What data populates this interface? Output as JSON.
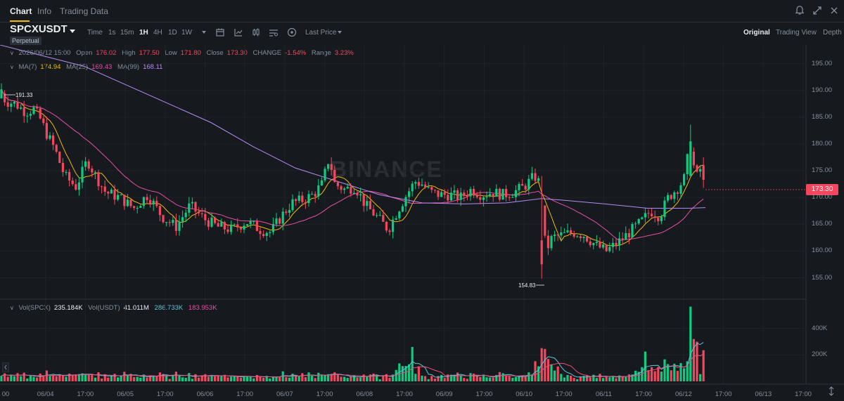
{
  "tabs": [
    {
      "label": "Chart",
      "active": true
    },
    {
      "label": "Info",
      "active": false
    },
    {
      "label": "Trading Data",
      "active": false
    }
  ],
  "top_icons": [
    "bell-icon",
    "expand-icon",
    "close-icon"
  ],
  "symbol": "SPCXUSDT",
  "contract_type": "Perpetual",
  "timeframes": [
    {
      "label": "Time",
      "active": false
    },
    {
      "label": "1s",
      "active": false
    },
    {
      "label": "15m",
      "active": false
    },
    {
      "label": "1H",
      "active": true
    },
    {
      "label": "4H",
      "active": false
    },
    {
      "label": "1D",
      "active": false
    },
    {
      "label": "1W",
      "active": false
    }
  ],
  "tool_icons": [
    "more-timeframes-icon",
    "calendar-icon",
    "indicator-icon",
    "candle-type-icon",
    "settings-icon",
    "add-indicator-icon"
  ],
  "price_type": "Last Price",
  "views": [
    {
      "label": "Original",
      "active": true
    },
    {
      "label": "Trading View",
      "active": false
    },
    {
      "label": "Depth",
      "active": false
    }
  ],
  "ohlc": {
    "date": "2026/06/12 15:00",
    "open_label": "Open",
    "open": "176.02",
    "high_label": "High",
    "high": "177.50",
    "low_label": "Low",
    "low": "171.80",
    "close_label": "Close",
    "close": "173.30",
    "change_label": "CHANGE",
    "change": "-1.54%",
    "range_label": "Range",
    "range": "3.23%"
  },
  "ma": {
    "ma7_label": "MA(7)",
    "ma7": "174.94",
    "ma25_label": "MA(25)",
    "ma25": "169.43",
    "ma99_label": "MA(99)",
    "ma99": "168.11"
  },
  "volume": {
    "vol_label": "Vol(SPCX)",
    "vol": "235.184K",
    "vol_usdt_label": "Vol(USDT)",
    "vol_usdt": "41.011M",
    "ma5": "286.733K",
    "ma10": "183.953K"
  },
  "watermark": "BINANCE",
  "current_price": "173.30",
  "annotations": {
    "high": "191.33",
    "low": "154.83"
  },
  "colors": {
    "up": "#0ecb81",
    "down": "#f6465d",
    "ma7": "#f0b90b",
    "ma25": "#e84fa5",
    "ma99": "#b48cf2",
    "vol_ma5": "#5fc5d8",
    "vol_ma10": "#e84f7d"
  },
  "chart_data": {
    "type": "candlestick",
    "interval": "1H",
    "price_axis": {
      "ticks": [
        "195.00",
        "190.00",
        "185.00",
        "180.00",
        "175.00",
        "170.00",
        "165.00",
        "160.00",
        "155.00"
      ],
      "ylim": [
        151,
        198.5
      ]
    },
    "volume_axis": {
      "ticks": [
        "400K",
        "200K"
      ],
      "ylim": [
        0,
        600000
      ]
    },
    "x_ticks": [
      "00",
      "06/04",
      "17:00",
      "06/05",
      "17:00",
      "06/06",
      "17:00",
      "06/07",
      "17:00",
      "06/08",
      "17:00",
      "06/09",
      "17:00",
      "06/10",
      "17:00",
      "06/11",
      "17:00",
      "06/12",
      "17:00",
      "06/13",
      "17:00"
    ],
    "anchors": [
      {
        "x": 0,
        "c": 190.0
      },
      {
        "x": 8,
        "c": 188.0
      },
      {
        "x": 22,
        "c": 187.5
      },
      {
        "x": 36,
        "c": 186.0
      },
      {
        "x": 48,
        "c": 186.5
      },
      {
        "x": 58,
        "c": 184.5
      },
      {
        "x": 66,
        "c": 182.0
      },
      {
        "x": 78,
        "c": 179.0
      },
      {
        "x": 92,
        "c": 174.0
      },
      {
        "x": 108,
        "c": 172.0
      },
      {
        "x": 118,
        "c": 175.0
      },
      {
        "x": 124,
        "c": 177.0
      },
      {
        "x": 134,
        "c": 174.5
      },
      {
        "x": 150,
        "c": 171.0
      },
      {
        "x": 170,
        "c": 170.0
      },
      {
        "x": 190,
        "c": 168.0
      },
      {
        "x": 210,
        "c": 170.5
      },
      {
        "x": 230,
        "c": 166.5
      },
      {
        "x": 250,
        "c": 164.5
      },
      {
        "x": 270,
        "c": 168.5
      },
      {
        "x": 290,
        "c": 166.0
      },
      {
        "x": 310,
        "c": 164.5
      },
      {
        "x": 330,
        "c": 164.0
      },
      {
        "x": 350,
        "c": 165.5
      },
      {
        "x": 370,
        "c": 164.0
      },
      {
        "x": 385,
        "c": 163.5
      },
      {
        "x": 400,
        "c": 166.5
      },
      {
        "x": 415,
        "c": 169.0
      },
      {
        "x": 430,
        "c": 169.5
      },
      {
        "x": 445,
        "c": 170.5
      },
      {
        "x": 458,
        "c": 172.5
      },
      {
        "x": 468,
        "c": 177.5
      },
      {
        "x": 476,
        "c": 172.5
      },
      {
        "x": 490,
        "c": 171.5
      },
      {
        "x": 505,
        "c": 172.0
      },
      {
        "x": 520,
        "c": 168.5
      },
      {
        "x": 535,
        "c": 166.5
      },
      {
        "x": 552,
        "c": 164.0
      },
      {
        "x": 565,
        "c": 167.5
      },
      {
        "x": 578,
        "c": 170.5
      },
      {
        "x": 590,
        "c": 173.0
      },
      {
        "x": 600,
        "c": 172.5
      },
      {
        "x": 612,
        "c": 171.0
      },
      {
        "x": 625,
        "c": 170.5
      },
      {
        "x": 640,
        "c": 170.5
      },
      {
        "x": 655,
        "c": 170.0
      },
      {
        "x": 670,
        "c": 171.5
      },
      {
        "x": 685,
        "c": 170.5
      },
      {
        "x": 700,
        "c": 171.0
      },
      {
        "x": 715,
        "c": 170.5
      },
      {
        "x": 730,
        "c": 171.0
      },
      {
        "x": 745,
        "c": 172.0
      },
      {
        "x": 760,
        "c": 174.0
      },
      {
        "x": 768,
        "c": 172.5
      },
      {
        "x": 776,
        "c": 160.0
      },
      {
        "x": 785,
        "c": 162.5
      },
      {
        "x": 800,
        "c": 163.0
      },
      {
        "x": 815,
        "c": 163.5
      },
      {
        "x": 830,
        "c": 163.0
      },
      {
        "x": 848,
        "c": 161.0
      },
      {
        "x": 862,
        "c": 160.0
      },
      {
        "x": 878,
        "c": 161.5
      },
      {
        "x": 895,
        "c": 163.5
      },
      {
        "x": 912,
        "c": 165.5
      },
      {
        "x": 925,
        "c": 167.5
      },
      {
        "x": 938,
        "c": 166.5
      },
      {
        "x": 950,
        "c": 170.0
      },
      {
        "x": 965,
        "c": 172.0
      },
      {
        "x": 975,
        "c": 174.0
      },
      {
        "x": 980,
        "c": 181.0
      },
      {
        "x": 986,
        "c": 176.0
      },
      {
        "x": 992,
        "c": 173.5
      },
      {
        "x": 997,
        "c": 176.0
      },
      {
        "x": 1003,
        "c": 173.3
      }
    ],
    "ma99_points": [
      {
        "x": 0,
        "y": 198.5
      },
      {
        "x": 60,
        "y": 196.5
      },
      {
        "x": 120,
        "y": 194.5
      },
      {
        "x": 180,
        "y": 191.0
      },
      {
        "x": 240,
        "y": 187.5
      },
      {
        "x": 300,
        "y": 184.0
      },
      {
        "x": 360,
        "y": 179.5
      },
      {
        "x": 420,
        "y": 175.5
      },
      {
        "x": 480,
        "y": 173.0
      },
      {
        "x": 540,
        "y": 170.5
      },
      {
        "x": 600,
        "y": 169.0
      },
      {
        "x": 660,
        "y": 168.8
      },
      {
        "x": 720,
        "y": 169.0
      },
      {
        "x": 770,
        "y": 169.8
      },
      {
        "x": 800,
        "y": 169.5
      },
      {
        "x": 860,
        "y": 168.8
      },
      {
        "x": 920,
        "y": 168.0
      },
      {
        "x": 980,
        "y": 168.0
      },
      {
        "x": 1003,
        "y": 168.11
      }
    ]
  }
}
